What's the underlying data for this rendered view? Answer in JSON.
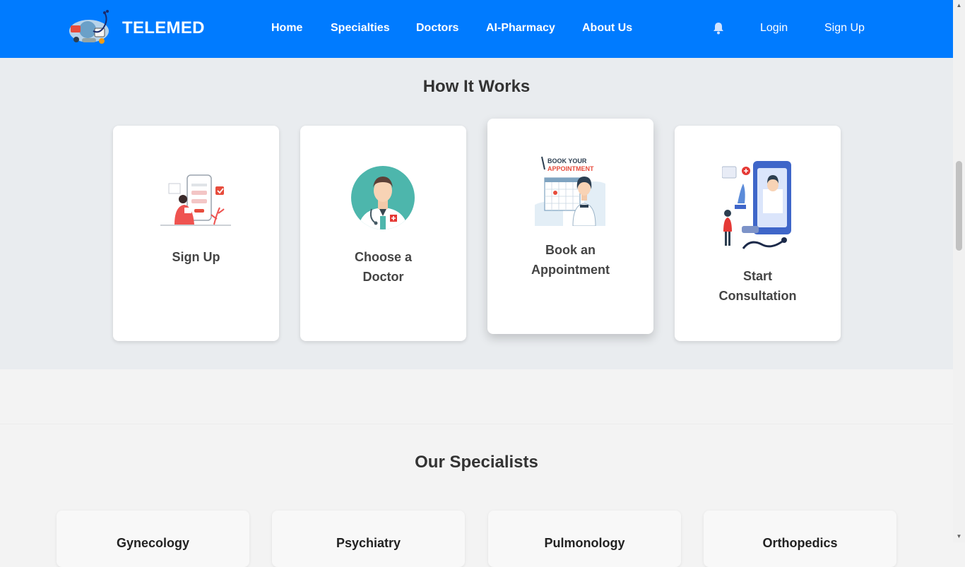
{
  "navbar": {
    "brand": "TELEMED",
    "links": [
      "Home",
      "Specialties",
      "Doctors",
      "AI-Pharmacy",
      "About Us"
    ],
    "login": "Login",
    "signup": "Sign Up"
  },
  "how_it_works": {
    "title": "How It Works",
    "steps": [
      {
        "line1": "Sign Up",
        "line2": ""
      },
      {
        "line1": "Choose a",
        "line2": "Doctor"
      },
      {
        "line1": "Book an",
        "line2": "Appointment",
        "illustration_text_1": "BOOK YOUR",
        "illustration_text_2": "APPOINTMENT"
      },
      {
        "line1": "Start",
        "line2": "Consultation"
      }
    ]
  },
  "specialists": {
    "title": "Our Specialists",
    "items": [
      "Gynecology",
      "Psychiatry",
      "Pulmonology",
      "Orthopedics"
    ]
  },
  "colors": {
    "primary": "#007bff",
    "section_bg": "#e9ecef",
    "page_bg": "#f3f3f3"
  }
}
